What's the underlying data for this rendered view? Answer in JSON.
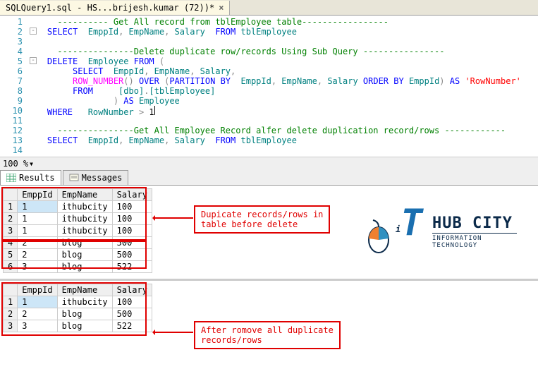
{
  "tab": {
    "title": "SQLQuery1.sql - HS...brijesh.kumar (72))*",
    "close": "×"
  },
  "code": {
    "l1a": "---------- ",
    "l1b": "Get All record from tblEmployee table",
    "l1c": "-----------------",
    "l2a": "SELECT",
    "l2b": "  EmppId",
    "l2c": " EmpName",
    "l2d": " Salary  ",
    "l2e": "FROM",
    "l2f": " tblEmployee",
    "l4a": "---------------",
    "l4b": "Delete duplicate row/records Using Sub Query ",
    "l4c": "----------------",
    "l5a": "DELETE",
    "l5b": "  Employee ",
    "l5c": "FROM ",
    "l5d": "(",
    "l6a": "         ",
    "l6b": "SELECT",
    "l6c": "  EmppId",
    "l6d": " EmpName",
    "l6e": " Salary",
    "l6f": ",",
    "l7a": "         ",
    "l7b": "ROW_NUMBER",
    "l7c": "()",
    "l7d": " OVER ",
    "l7e": "(",
    "l7f": "PARTITION",
    "l7g": " BY",
    "l7h": "  EmppId",
    "l7i": " EmpName",
    "l7j": " Salary ",
    "l7k": "ORDER",
    "l7l": " BY",
    "l7m": " EmppId",
    "l7n": ")",
    "l7o": " AS ",
    "l7p": "'RowNumber'",
    "l8a": "         ",
    "l8b": "FROM",
    "l8c": "     [dbo]",
    "l8d": ".",
    "l8e": "[tblEmployee]",
    "l9a": "                 ",
    "l9b": ")",
    "l9c": " AS",
    "l9d": " Employee",
    "l10a": "WHERE",
    "l10b": "   RowNumber ",
    "l10c": ">",
    "l10d": " 1",
    "l12a": "---------------",
    "l12b": "Get All Employee Record alfer delete duplication record/rows ",
    "l12c": "------------",
    "l13a": "SELECT",
    "l13b": "  EmppId",
    "l13c": " EmpName",
    "l13d": " Salary  ",
    "l13e": "FROM",
    "l13f": " tblEmployee",
    "comma": ","
  },
  "zoom": "100 %",
  "tabs": {
    "results": "Results",
    "messages": "Messages"
  },
  "grid1": {
    "headers": [
      "EmppId",
      "EmpName",
      "Salary"
    ],
    "rows": [
      [
        "1",
        "1",
        "ithubcity",
        "100"
      ],
      [
        "2",
        "1",
        "ithubcity",
        "100"
      ],
      [
        "3",
        "1",
        "ithubcity",
        "100"
      ],
      [
        "4",
        "2",
        "blog",
        "500"
      ],
      [
        "5",
        "2",
        "blog",
        "500"
      ],
      [
        "6",
        "3",
        "blog",
        "522"
      ]
    ]
  },
  "grid2": {
    "headers": [
      "EmppId",
      "EmpName",
      "Salary"
    ],
    "rows": [
      [
        "1",
        "1",
        "ithubcity",
        "100"
      ],
      [
        "2",
        "2",
        "blog",
        "500"
      ],
      [
        "3",
        "3",
        "blog",
        "522"
      ]
    ]
  },
  "callout1a": "Dupicate records/rows in",
  "callout1b": "table before delete",
  "callout2a": "After romove all duplicate",
  "callout2b": "records/rows",
  "logo": {
    "it_i": "i",
    "it_t": "T",
    "hub": "HUB CITY",
    "sub": "INFORMATION TECHNOLOGY"
  }
}
